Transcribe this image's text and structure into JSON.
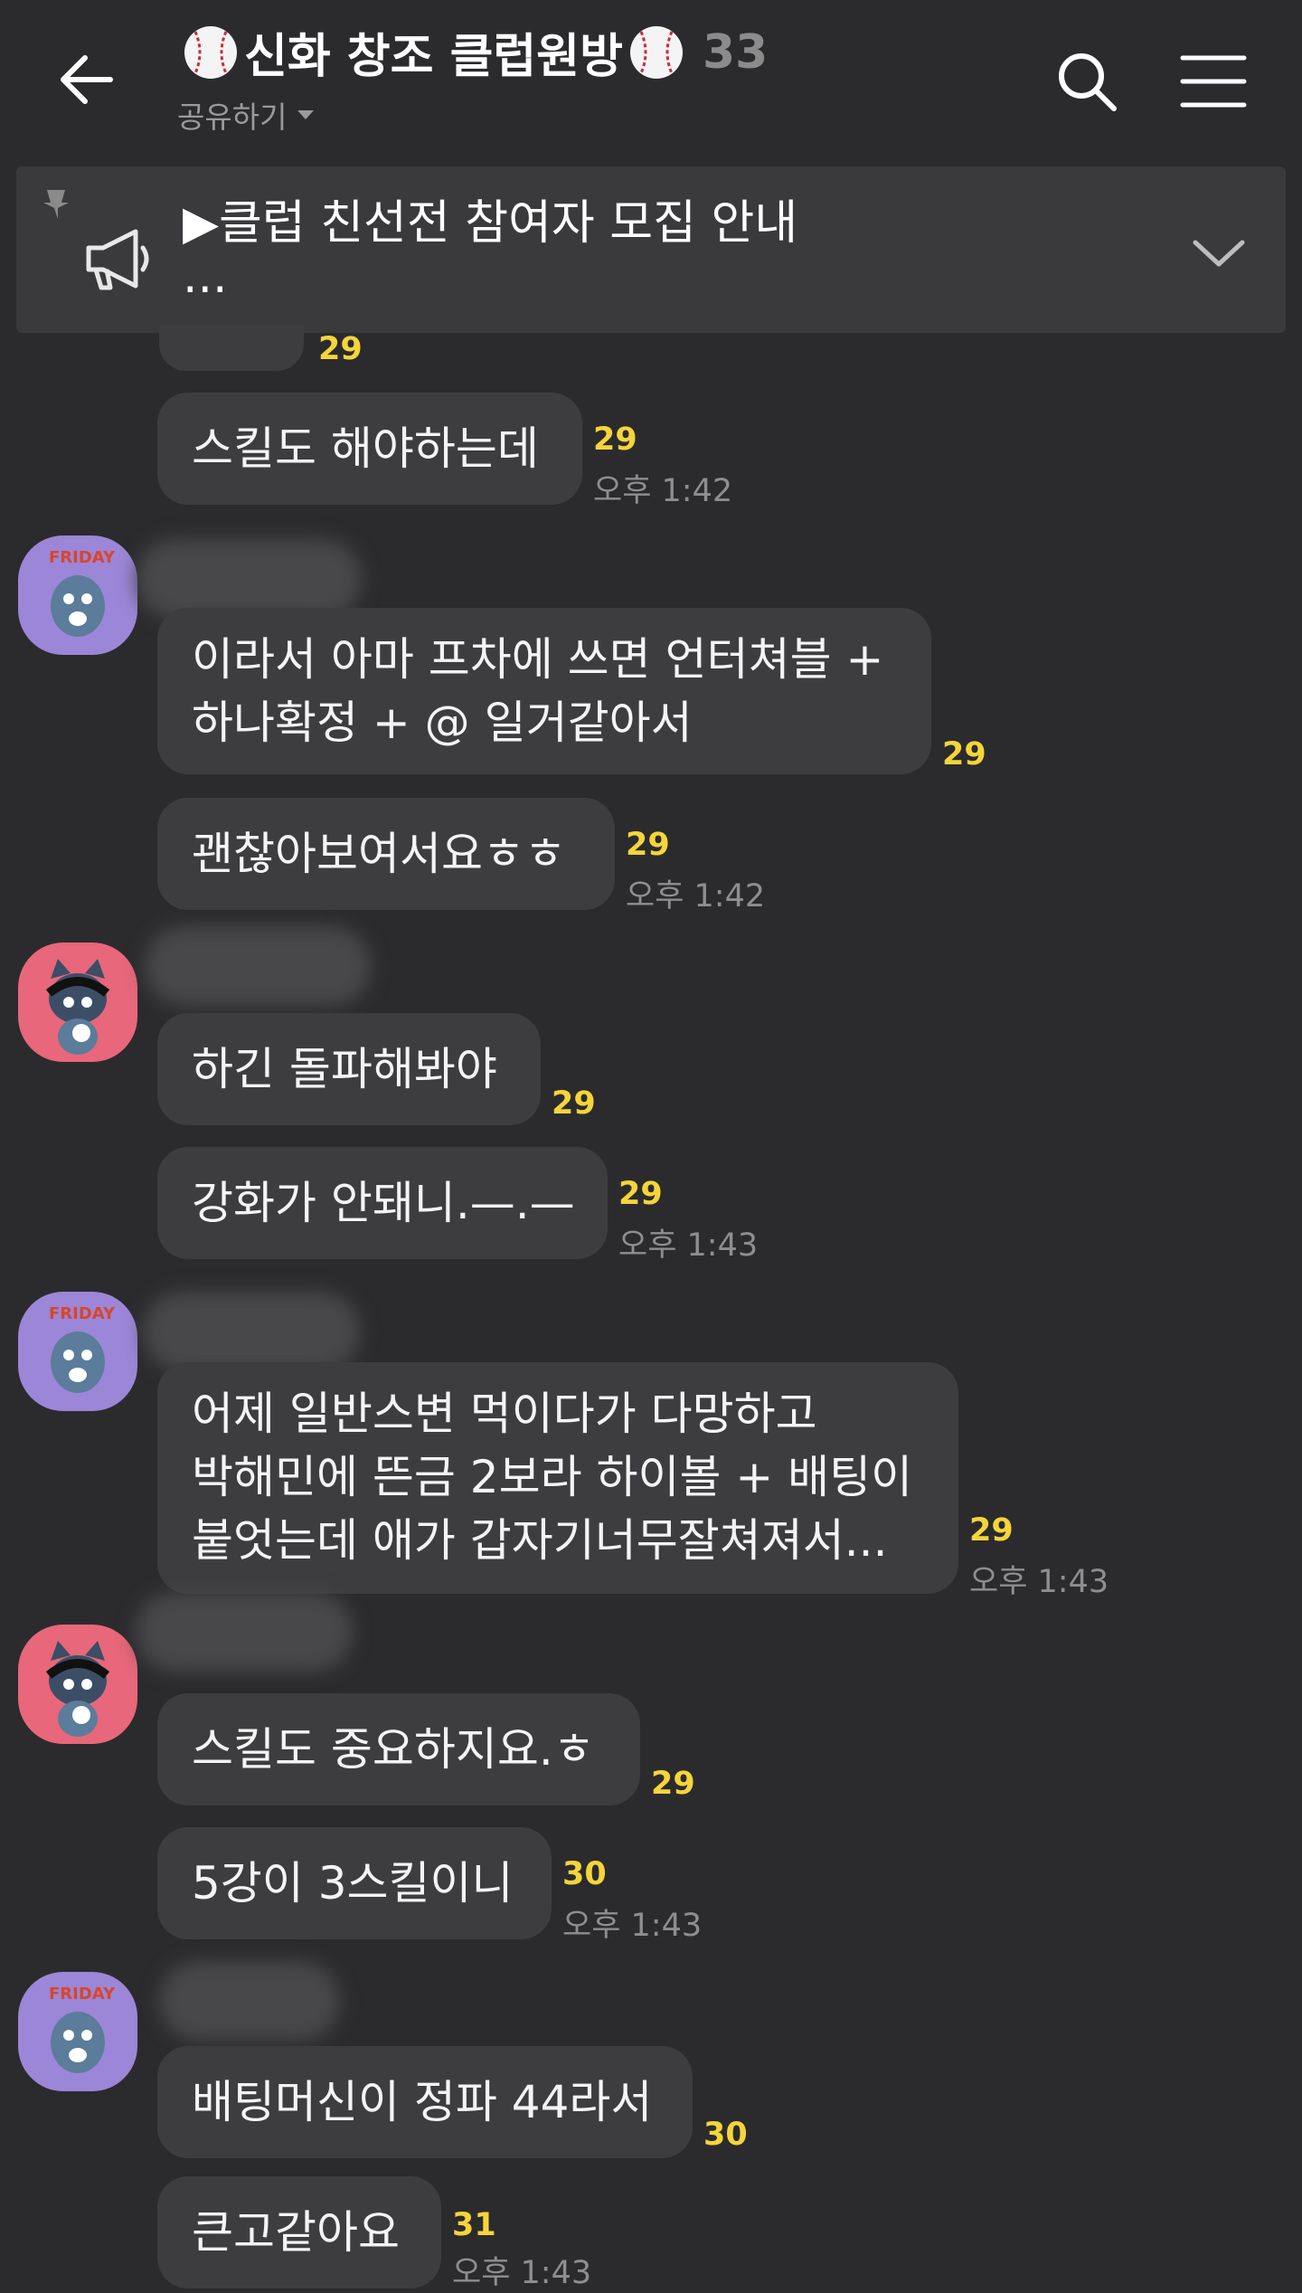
{
  "header": {
    "title": "신화 창조 클럽원방",
    "member_count": "33",
    "share_label": "공유하기"
  },
  "notice": {
    "text_line1": "▶클럽 친선전 참여자 모집 안내",
    "text_line2": "..."
  },
  "messages": [
    {
      "text": "스킬도 해야하는데",
      "unread": "29",
      "time": "오후 1:42"
    },
    {
      "text_lines": [
        "이라서 아마 프차에 쓰면 언터쳐블 +",
        "하나확정 + @ 일거같아서"
      ],
      "unread": "29"
    },
    {
      "text": "괜찮아보여서요ㅎㅎ",
      "unread": "29",
      "time": "오후 1:42"
    },
    {
      "text": "하긴 돌파해봐야",
      "unread": "29"
    },
    {
      "text": "강화가 안돼니.—.—",
      "unread": "29",
      "time": "오후 1:43"
    },
    {
      "text_lines": [
        "어제 일반스변 먹이다가 다망하고",
        "박해민에 뜬금 2보라 하이볼 + 배팅이",
        "붙엇는데 애가 갑자기너무잘쳐져서..."
      ],
      "unread": "29",
      "time": "오후 1:43"
    },
    {
      "text": "스킬도 중요하지요.ㅎ",
      "unread": "29"
    },
    {
      "text": "5강이 3스킬이니",
      "unread": "30",
      "time": "오후 1:43"
    },
    {
      "text": "배팅머신이 정파 44라서",
      "unread": "30"
    },
    {
      "text": "큰고같아요",
      "unread": "31",
      "time": "오후 1:43"
    }
  ],
  "top_partial_unread": "29",
  "colors": {
    "background": "#2b2b2d",
    "bubble": "#3d3d3f",
    "unread": "#f5d53a",
    "avatar_purple": "#9c86d8",
    "avatar_pink": "#e8677a"
  }
}
